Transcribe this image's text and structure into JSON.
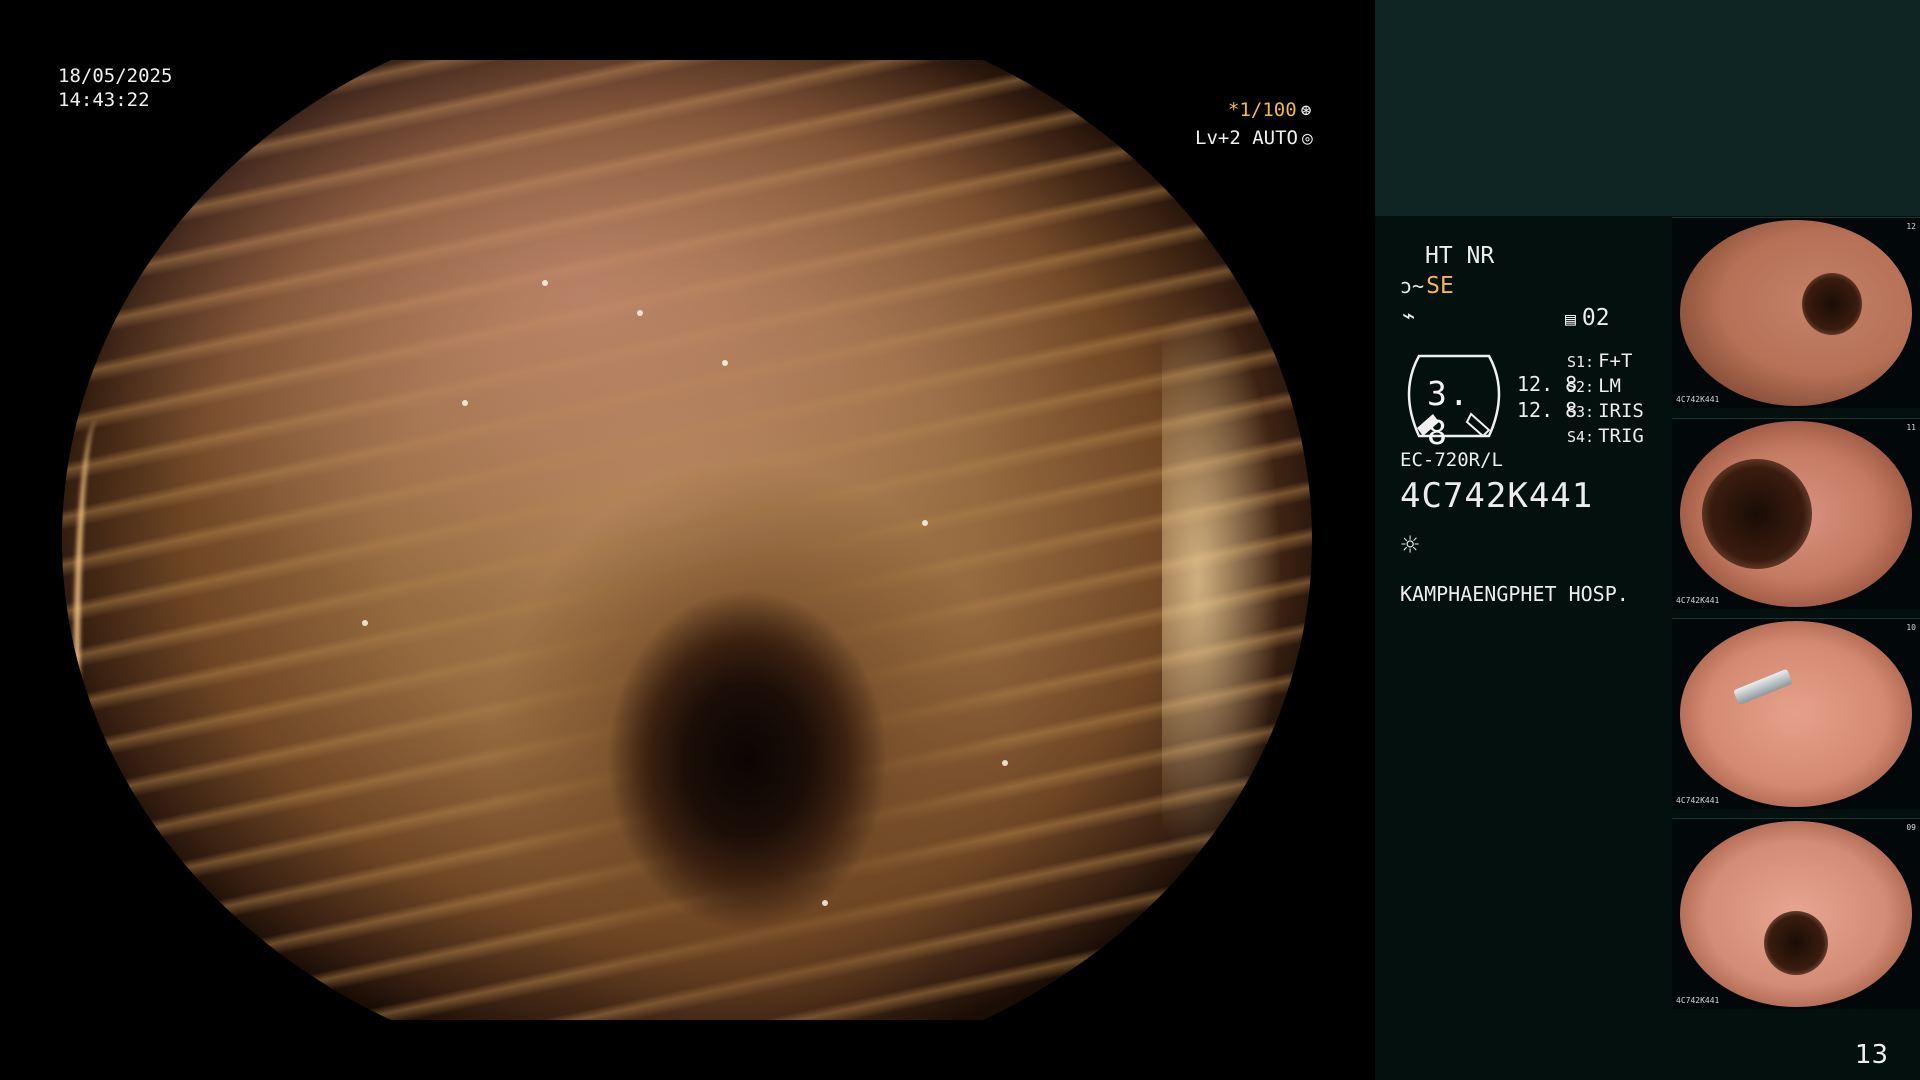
{
  "main_view": {
    "date": "18/05/2025",
    "time": "14:43:22",
    "shutter": "*1/100",
    "shutter_icon": "aperture-icon",
    "level": "Lv+2 AUTO",
    "level_icon": "target-icon"
  },
  "panel": {
    "mode_line_1": "HT NR",
    "mode_se_label": "SE",
    "mode_se_icon": "structure-icon",
    "wave_icon": "wave-icon",
    "memo_icon": "memo-icon",
    "memo_count": "02",
    "gauge_value": "3. 8",
    "gauge_sub_1": "12. 8",
    "gauge_sub_2": "12. 8",
    "switches": [
      {
        "key": "S1:",
        "value": "F+T"
      },
      {
        "key": "S2:",
        "value": "LM"
      },
      {
        "key": "S3:",
        "value": "IRIS"
      },
      {
        "key": "S4:",
        "value": "TRIG"
      }
    ],
    "scope_model": "EC-720R/L",
    "scope_serial": "4C742K441",
    "light_icon": "light-source-icon",
    "hospital": "KAMPHAENGPHET HOSP.",
    "page_number": "13"
  },
  "thumbnails": [
    {
      "mini_text": "4C742K441",
      "index": "12"
    },
    {
      "mini_text": "4C742K441",
      "index": "11"
    },
    {
      "mini_text": "4C742K441",
      "index": "10"
    },
    {
      "mini_text": "4C742K441",
      "index": "09"
    }
  ],
  "colors": {
    "accent_yellow": "#f2b84a",
    "panel_bg": "#04100e",
    "panel_top_bg": "#0f2523"
  }
}
